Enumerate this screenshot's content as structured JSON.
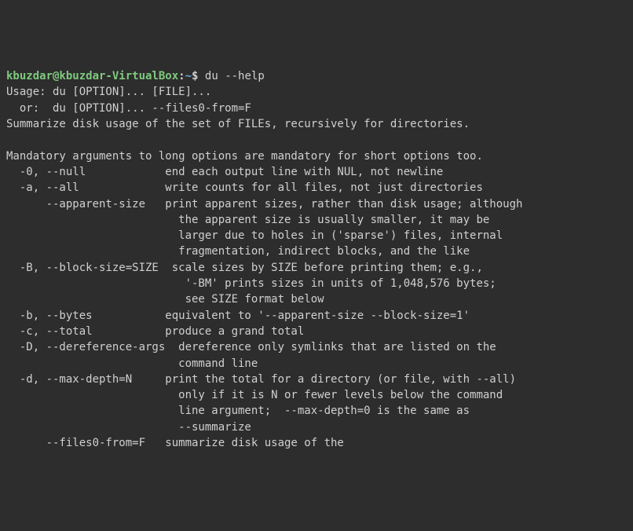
{
  "prompt": {
    "user": "kbuzdar@kbuzdar-VirtualBox",
    "colon": ":",
    "path": "~",
    "dollar": "$"
  },
  "command": "du --help",
  "lines": {
    "l0": "Usage: du [OPTION]... [FILE]...",
    "l1": "  or:  du [OPTION]... --files0-from=F",
    "l2": "Summarize disk usage of the set of FILEs, recursively for directories.",
    "l3": "",
    "l4": "Mandatory arguments to long options are mandatory for short options too.",
    "l5": "  -0, --null            end each output line with NUL, not newline",
    "l6": "  -a, --all             write counts for all files, not just directories",
    "l7": "      --apparent-size   print apparent sizes, rather than disk usage; although",
    "l8": "                          the apparent size is usually smaller, it may be",
    "l9": "                          larger due to holes in ('sparse') files, internal",
    "l10": "                          fragmentation, indirect blocks, and the like",
    "l11": "  -B, --block-size=SIZE  scale sizes by SIZE before printing them; e.g.,",
    "l12": "                           '-BM' prints sizes in units of 1,048,576 bytes;",
    "l13": "                           see SIZE format below",
    "l14": "  -b, --bytes           equivalent to '--apparent-size --block-size=1'",
    "l15": "  -c, --total           produce a grand total",
    "l16": "  -D, --dereference-args  dereference only symlinks that are listed on the",
    "l17": "                          command line",
    "l18": "  -d, --max-depth=N     print the total for a directory (or file, with --all)",
    "l19": "                          only if it is N or fewer levels below the command",
    "l20": "                          line argument;  --max-depth=0 is the same as",
    "l21": "                          --summarize",
    "l22": "      --files0-from=F   summarize disk usage of the"
  }
}
